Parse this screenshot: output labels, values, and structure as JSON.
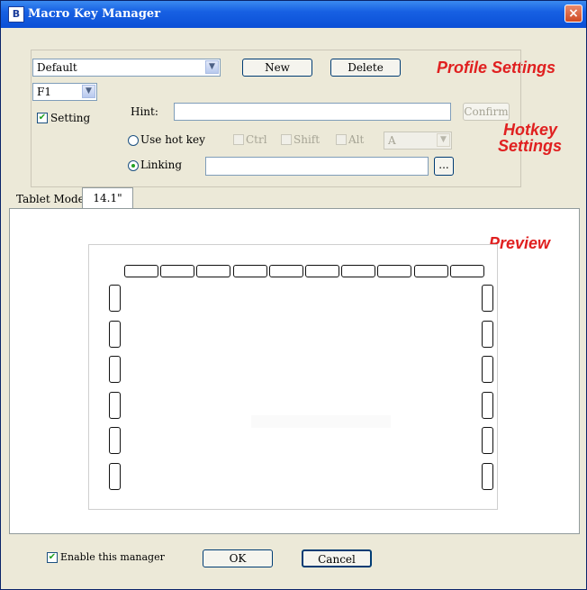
{
  "window": {
    "title": "Macro Key Manager",
    "icon": "app-icon",
    "close": "×"
  },
  "profile": {
    "selected": "Default",
    "new_label": "New",
    "delete_label": "Delete",
    "annotation": "Profile Settings"
  },
  "hotkey": {
    "key_selected": "F1",
    "setting_label": "Setting",
    "setting_checked": true,
    "hint_label": "Hint:",
    "hint_value": "",
    "confirm_label": "Confirm",
    "use_hot_key_label": "Use hot key",
    "ctrl_label": "Ctrl",
    "shift_label": "Shift",
    "alt_label": "Alt",
    "key_value": "A",
    "linking_label": "Linking",
    "linking_value": "",
    "browse_label": "...",
    "annotation_line1": "Hotkey",
    "annotation_line2": "Settings"
  },
  "tablet": {
    "label": "Tablet Mode:",
    "value": "14.1\""
  },
  "preview": {
    "annotation": "Preview",
    "top_keys": 10,
    "left_keys": 6,
    "right_keys": 6
  },
  "footer": {
    "enable_label": "Enable this manager",
    "enable_checked": true,
    "ok_label": "OK",
    "cancel_label": "Cancel"
  }
}
